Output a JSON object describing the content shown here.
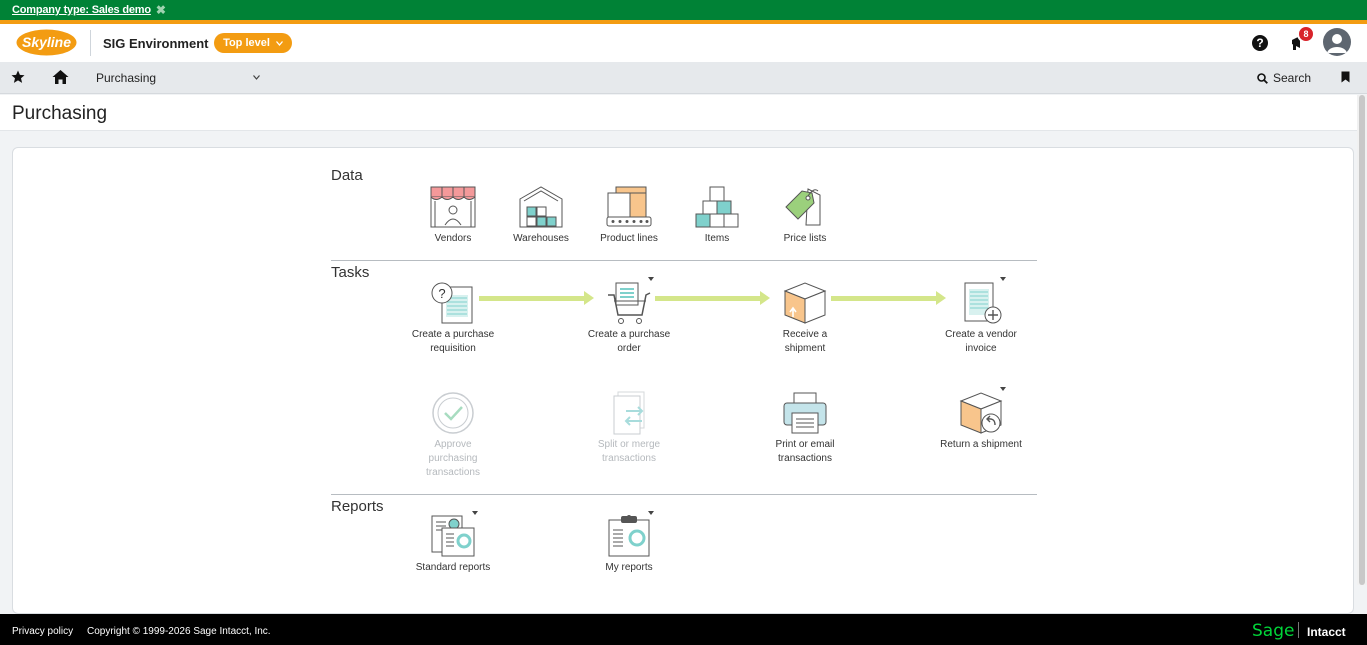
{
  "company_strip": {
    "text": "Company type: Sales demo",
    "close_glyph": "✖"
  },
  "header": {
    "logo_text": "Skyline",
    "environment": "SIG Environment",
    "level_selector": "Top level",
    "notifications_count": "8",
    "help_glyph": "?"
  },
  "nav": {
    "module": "Purchasing",
    "search_label": "Search"
  },
  "page": {
    "title": "Purchasing"
  },
  "sections": {
    "data": {
      "title": "Data",
      "items": [
        {
          "label": "Vendors",
          "icon": "vendors-icon"
        },
        {
          "label": "Warehouses",
          "icon": "warehouses-icon"
        },
        {
          "label": "Product lines",
          "icon": "product-lines-icon"
        },
        {
          "label": "Items",
          "icon": "items-icon"
        },
        {
          "label": "Price lists",
          "icon": "price-lists-icon"
        }
      ]
    },
    "tasks": {
      "title": "Tasks",
      "items": [
        {
          "label_line1": "Create a purchase",
          "label_line2": "requisition",
          "icon": "purchase-requisition-icon"
        },
        {
          "label_line1": "Create a purchase",
          "label_line2": "order",
          "icon": "purchase-order-cart-icon"
        },
        {
          "label_line1": "Receive a",
          "label_line2": "shipment",
          "icon": "receive-shipment-box-icon"
        },
        {
          "label_line1": "Create a vendor",
          "label_line2": "invoice",
          "icon": "vendor-invoice-icon"
        },
        {
          "label_line1": "Approve",
          "label_line2": "purchasing",
          "label_line3": "transactions",
          "icon": "approve-check-icon"
        },
        {
          "label_line1": "Split or merge",
          "label_line2": "transactions",
          "icon": "split-merge-icon"
        },
        {
          "label_line1": "Print or email",
          "label_line2": "transactions",
          "icon": "printer-icon"
        },
        {
          "label_line1": "Return a shipment",
          "icon": "return-shipment-icon"
        }
      ]
    },
    "reports": {
      "title": "Reports",
      "items": [
        {
          "label": "Standard reports",
          "icon": "standard-reports-icon"
        },
        {
          "label": "My reports",
          "icon": "my-reports-icon"
        }
      ]
    }
  },
  "footer": {
    "privacy": "Privacy policy",
    "copyright": "Copyright © 1999-2026 Sage Intacct, Inc.",
    "brand_sage": "Sage",
    "brand_intacct": "Intacct"
  },
  "colors": {
    "company_strip": "#008236",
    "accent_orange": "#f39c12",
    "flow_arrow": "#d4e68a",
    "badge_red": "#d8232a",
    "icon_teal": "#7fd1cc",
    "icon_peach": "#f8c58c"
  }
}
